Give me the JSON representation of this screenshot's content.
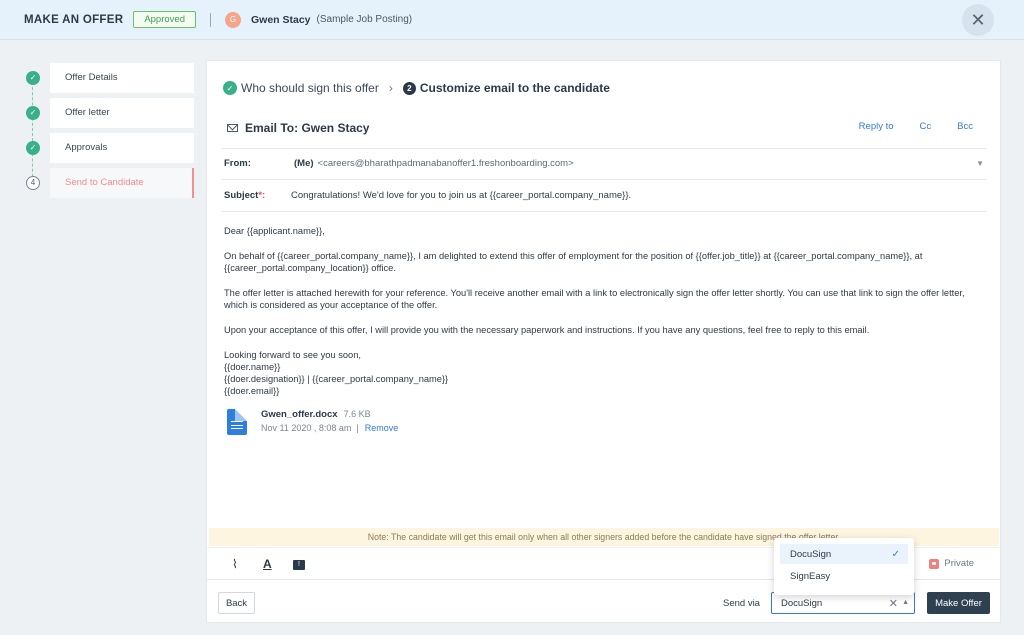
{
  "header": {
    "title": "MAKE AN OFFER",
    "status_badge": "Approved",
    "avatar_initial": "G",
    "candidate_name": "Gwen Stacy",
    "job_posting": "(Sample Job Posting)"
  },
  "steps": [
    {
      "label": "Offer Details",
      "state": "done"
    },
    {
      "label": "Offer letter",
      "state": "done"
    },
    {
      "label": "Approvals",
      "state": "done"
    },
    {
      "label": "Send to Candidate",
      "state": "active",
      "number": "4"
    }
  ],
  "breadcrumb": {
    "step1": "Who should sign this offer",
    "step2_number": "2",
    "step2": "Customize email to the candidate"
  },
  "email": {
    "to_label": "Email To: Gwen Stacy",
    "links": {
      "reply_to": "Reply to",
      "cc": "Cc",
      "bcc": "Bcc"
    },
    "from_label": "From:",
    "from_me": "(Me)",
    "from_address": "<careers@bharathpadmanabanoffer1.freshonboarding.com>",
    "subject_label": "Subject",
    "subject_required": "*:",
    "subject": "Congratulations! We'd love for you to join us at {{career_portal.company_name}}.",
    "body": {
      "greeting": "Dear {{applicant.name}},",
      "para1": "On behalf of {{career_portal.company_name}}, I am delighted to extend this offer of employment for the position of {{offer.job_title}} at {{career_portal.company_name}}, at {{career_portal.company_location}} office.",
      "para2": "The offer letter is attached herewith for your reference. You'll receive another email with a link to electronically sign the offer letter shortly. You can use that link to sign the offer letter, which is considered as your acceptance of the offer.",
      "para3": "Upon your acceptance of this offer, I will provide you with the necessary paperwork and instructions. If you have any questions, feel free to reply to this email.",
      "sign1": "Looking forward to see you soon,",
      "sign2": "{{doer.name}}",
      "sign3": "{{doer.designation}} | {{career_portal.company_name}}",
      "sign4": "{{doer.email}}"
    },
    "attachment": {
      "name": "Gwen_offer.docx",
      "size": "7.6 KB",
      "date": "Nov 11 2020 , 8:08 am",
      "separator": "|",
      "remove": "Remove"
    },
    "note": "Note: The candidate will get this email only when all other signers added before the candidate have signed the offer letter."
  },
  "toolbar": {
    "text_icon_glyph": "A",
    "private_label": "Private"
  },
  "footer": {
    "back_label": "Back",
    "send_via_label": "Send via",
    "send_via_value": "DocuSign",
    "make_offer_label": "Make Offer"
  },
  "send_via_options": [
    {
      "label": "DocuSign",
      "selected": true
    },
    {
      "label": "SignEasy",
      "selected": false
    }
  ]
}
